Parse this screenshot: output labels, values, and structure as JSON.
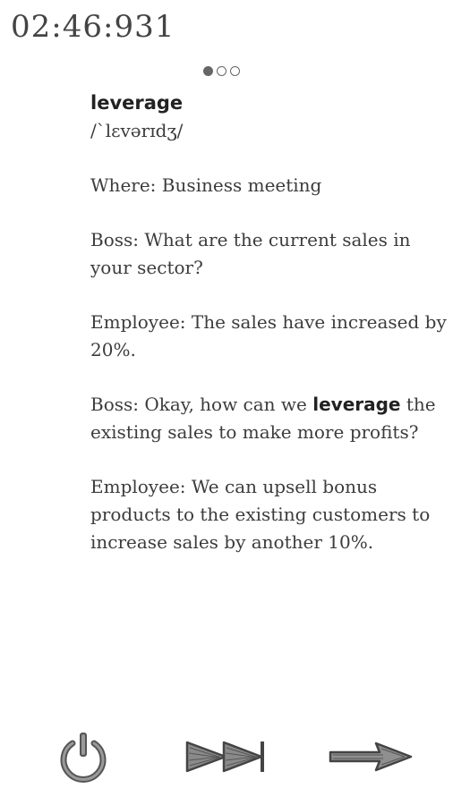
{
  "timer": "02:46:931",
  "pager": {
    "count": 3,
    "active_index": 0
  },
  "card": {
    "word": "leverage",
    "phonetic": "/`lɛvərɪdʒ/",
    "where": "Where: Business meeting",
    "line1": "Boss: What are the current sales in your sector?",
    "line2": "Employee: The sales have increased by 20%.",
    "line3_before": "Boss: Okay, how can we ",
    "line3_highlight": "leverage",
    "line3_after": " the existing sales to make more profits?",
    "line4": "Employee: We can upsell bonus products to the existing customers to increase sales by another 10%."
  },
  "controls": {
    "power_icon": "power-icon",
    "skip_icon": "fast-forward-icon",
    "next_icon": "right-arrow-icon"
  }
}
